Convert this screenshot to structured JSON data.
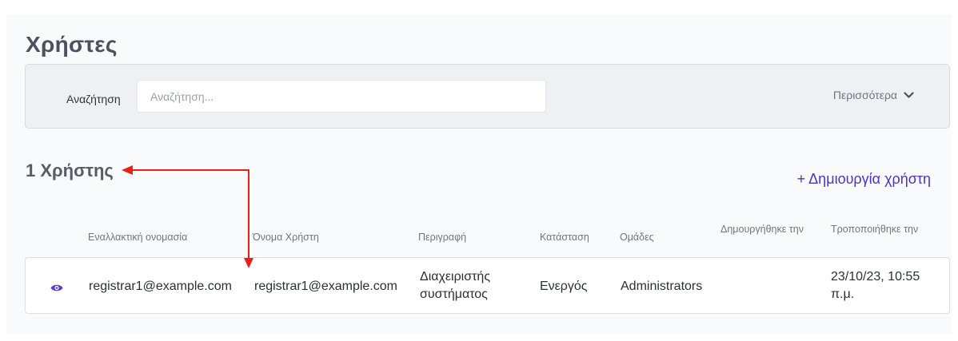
{
  "page": {
    "title": "Χρήστες"
  },
  "filters": {
    "search_label": "Αναζήτηση",
    "search_placeholder": "Αναζήτηση...",
    "search_value": "",
    "more_label": "Περισσότερα"
  },
  "results": {
    "count_text": "1 Χρήστης",
    "create_label": "+ Δημιουργία χρήστη"
  },
  "table": {
    "columns": [
      "Εναλλακτική ονομασία",
      "Όνομα Χρήστη",
      "Περιγραφή",
      "Κατάσταση",
      "Ομάδες",
      "Δημουργήθηκε την",
      "Τροποποιήθηκε την"
    ],
    "rows": [
      {
        "alias": "registrar1@example.com",
        "username": "registrar1@example.com",
        "description": "Διαχειριστής συστήματος",
        "status": "Ενεργός",
        "groups": "Administrators",
        "created": "",
        "modified": "23/10/23, 10:55 π.μ."
      }
    ]
  },
  "colors": {
    "accent": "#4f2ed8",
    "annotation_arrow": "#e8201a",
    "eye_icon": "#5b3be0"
  },
  "icons": [
    "chevron-down-icon",
    "eye-icon"
  ]
}
